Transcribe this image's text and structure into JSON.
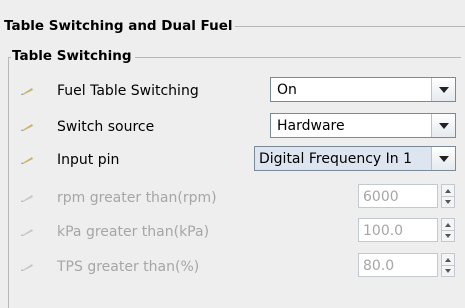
{
  "panel": {
    "title": "Table Switching and Dual Fuel",
    "section_title": "Table Switching"
  },
  "rows": [
    {
      "label": "Fuel Table Switching",
      "value": "On",
      "enabled": true,
      "control": "combo",
      "icon": "help-pencil-icon"
    },
    {
      "label": "Switch source",
      "value": "Hardware",
      "enabled": true,
      "control": "combo",
      "icon": "help-pencil-icon"
    },
    {
      "label": "Input pin",
      "value": "Digital Frequency In 1",
      "enabled": true,
      "control": "combo",
      "icon": "help-pencil-icon"
    },
    {
      "label": "rpm greater than(rpm)",
      "value": "6000",
      "enabled": false,
      "control": "spinner",
      "icon": "help-pencil-icon"
    },
    {
      "label": "kPa greater than(kPa)",
      "value": "100.0",
      "enabled": false,
      "control": "spinner",
      "icon": "help-pencil-icon"
    },
    {
      "label": "TPS greater than(%)",
      "value": "80.0",
      "enabled": false,
      "control": "spinner",
      "icon": "help-pencil-icon"
    }
  ],
  "colors": {
    "background": "#eeeeee",
    "disabled_text": "#a6a6a6",
    "icon_enabled": "#c9b36a",
    "icon_disabled": "#c8c8c8"
  }
}
